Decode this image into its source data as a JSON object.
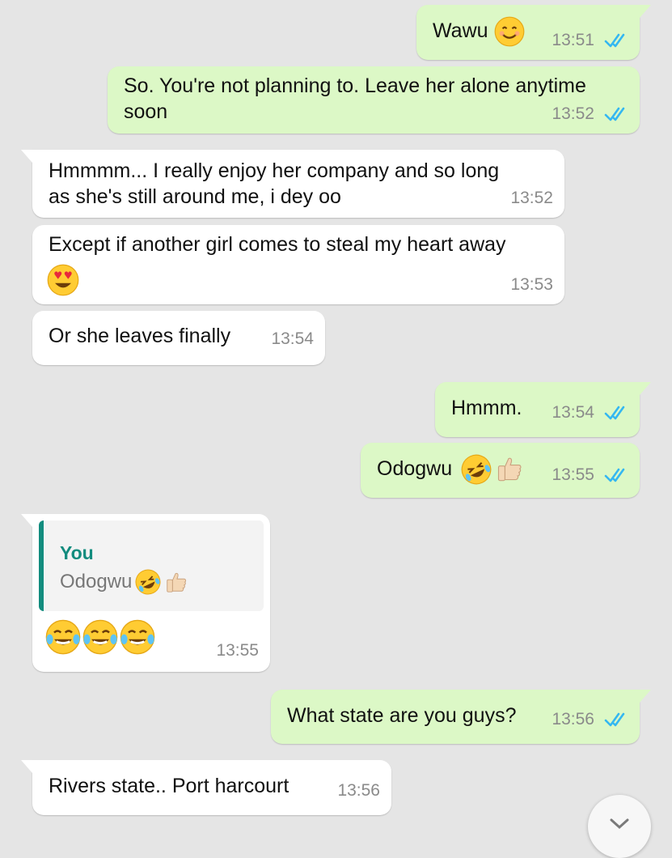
{
  "messages": [
    {
      "text": "Wawu",
      "time": "13:51",
      "emoji": [
        "smiling-face"
      ]
    },
    {
      "text_line1": "So. You're not planning to. Leave her alone anytime",
      "text_line2": "soon",
      "time": "13:52"
    },
    {
      "text_line1": "Hmmmm... I really enjoy her company and so long",
      "text_line2": "as she's still around me, i dey oo",
      "time": "13:52"
    },
    {
      "text": "Except if another girl comes to steal my heart away",
      "time": "13:53",
      "emoji": [
        "heart-eyes"
      ]
    },
    {
      "text": "Or she leaves finally",
      "time": "13:54"
    },
    {
      "text": "Hmmm.",
      "time": "13:54"
    },
    {
      "text": "Odogwu",
      "time": "13:55",
      "emoji": [
        "rolling-laughing",
        "thumbs-up"
      ]
    },
    {
      "quote_author": "You",
      "quote_text": "Odogwu",
      "time": "13:55",
      "emoji": [
        "tears-of-joy",
        "tears-of-joy",
        "tears-of-joy"
      ]
    },
    {
      "text": "What state are you guys?",
      "time": "13:56"
    },
    {
      "text": "Rivers state.. Port harcourt",
      "time": "13:56"
    }
  ],
  "colors": {
    "outgoing_bubble": "#dcf8c6",
    "incoming_bubble": "#ffffff",
    "background": "#e5e5e5",
    "read_ticks": "#34b7f1",
    "quote_accent": "#128c7e"
  },
  "icons": {
    "read_receipt": "double-check-icon",
    "scroll_down": "chevron-down-icon"
  }
}
